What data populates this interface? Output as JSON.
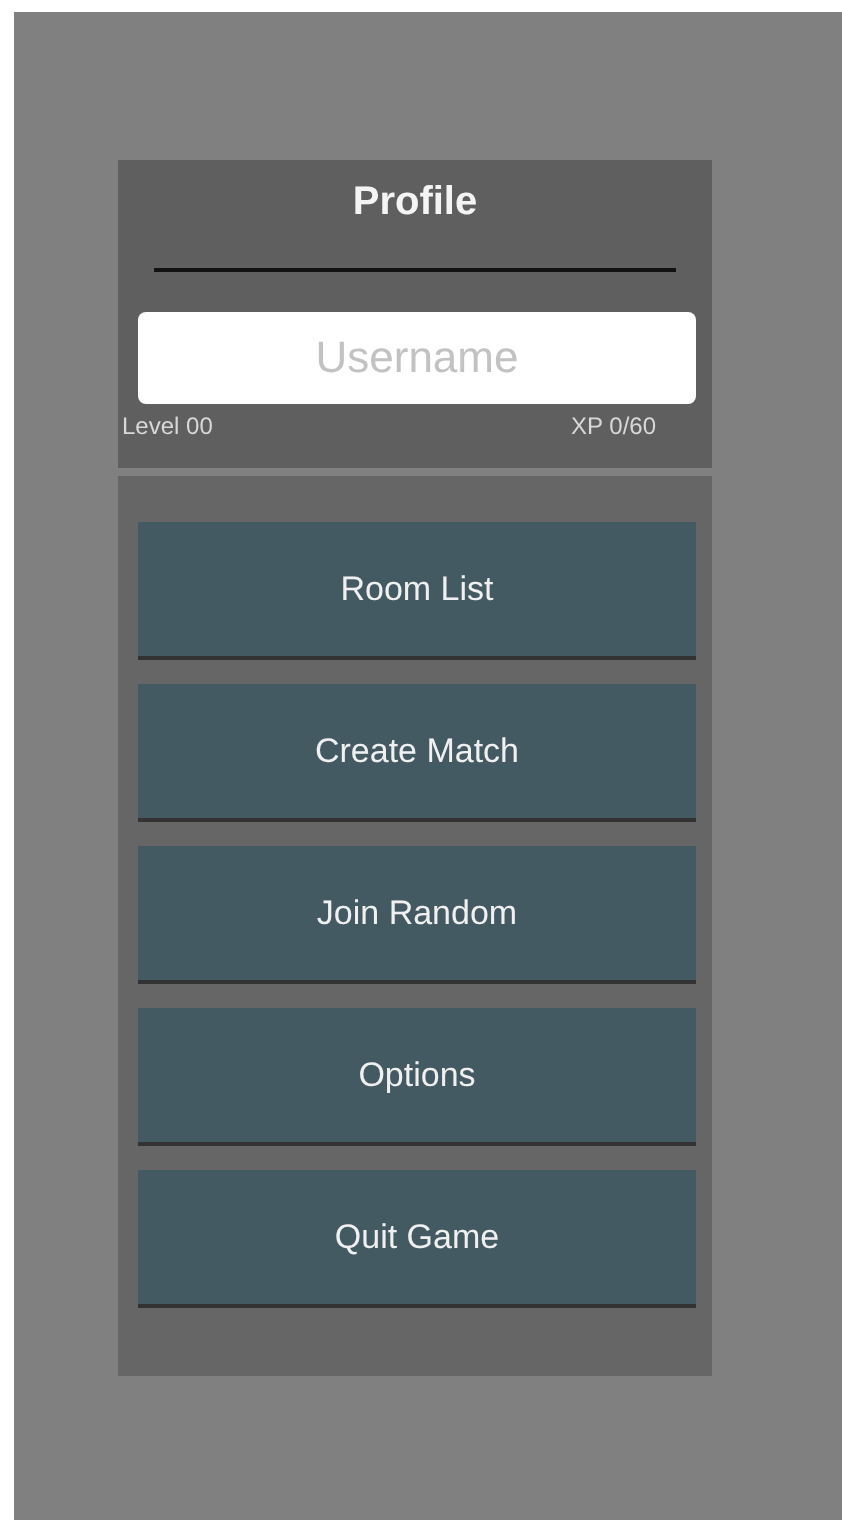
{
  "profile": {
    "title": "Profile",
    "username": {
      "placeholder": "Username"
    },
    "level": "Level 00",
    "xp": "XP 0/60"
  },
  "menu": [
    "Room List",
    "Create Match",
    "Join Random",
    "Options",
    "Quit Game"
  ]
}
